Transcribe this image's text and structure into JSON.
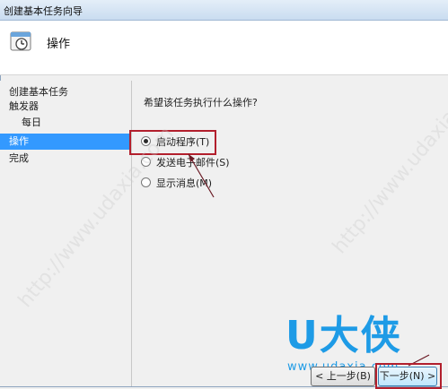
{
  "window": {
    "title": "创建基本任务向导"
  },
  "header": {
    "title": "操作",
    "icon": "task-scheduler-clock-icon"
  },
  "nav": {
    "items": [
      {
        "label": "创建基本任务",
        "selected": false
      },
      {
        "label": "触发器",
        "selected": false
      },
      {
        "label": "每日",
        "selected": false
      },
      {
        "label": "操作",
        "selected": true
      },
      {
        "label": "完成",
        "selected": false
      }
    ]
  },
  "content": {
    "question": "希望该任务执行什么操作?",
    "options": [
      {
        "label": "启动程序(T)",
        "checked": true
      },
      {
        "label": "发送电子邮件(S)",
        "checked": false
      },
      {
        "label": "显示消息(M)",
        "checked": false
      }
    ]
  },
  "buttons": {
    "back_label": "< 上一步(B)",
    "next_label": "下一步(N) >"
  },
  "watermark": {
    "logo": "U大侠",
    "url": "www.udaxia.com",
    "diagonal": "http://www.udaxia.com"
  },
  "colors": {
    "selection": "#3399ff",
    "highlight_box": "#b21f2d",
    "logo_blue": "#1e9be6"
  }
}
